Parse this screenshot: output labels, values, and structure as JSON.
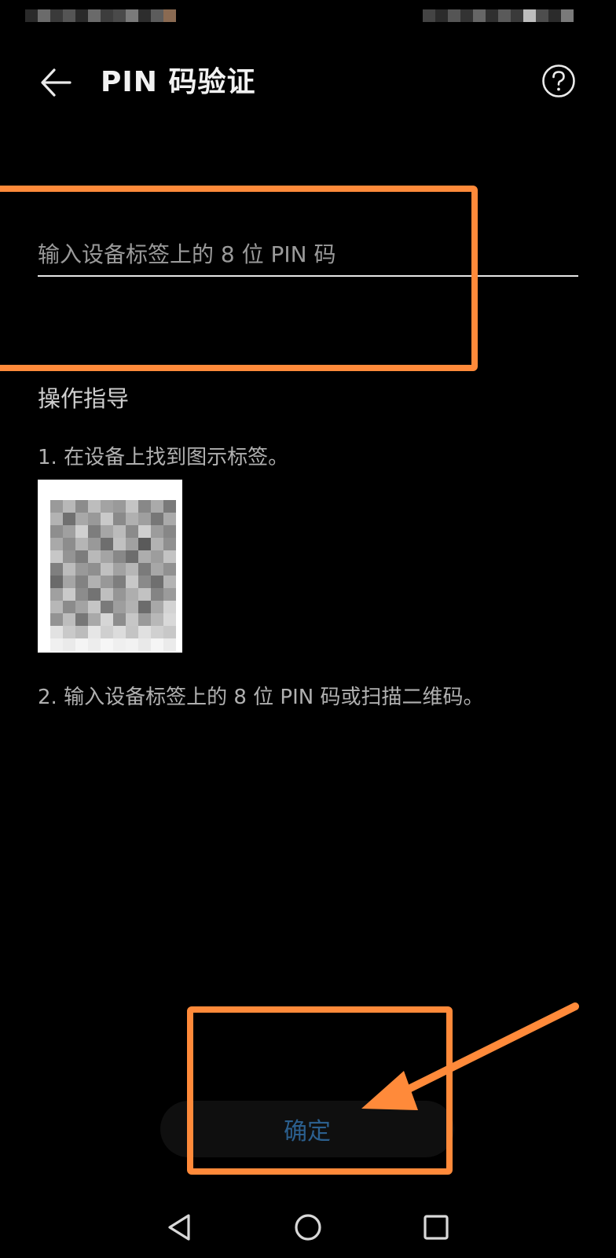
{
  "header": {
    "title": "PIN 码验证"
  },
  "pin_field": {
    "placeholder": "输入设备标签上的 8 位 PIN 码",
    "value": ""
  },
  "guide": {
    "title": "操作指导",
    "step1": "1. 在设备上找到图示标签。",
    "step2": "2. 输入设备标签上的 8 位 PIN 码或扫描二维码。"
  },
  "confirm_label": "确定",
  "colors": {
    "background": "#000000",
    "annotation": "#ff8a3a",
    "confirm_text": "#2b5f8e"
  }
}
